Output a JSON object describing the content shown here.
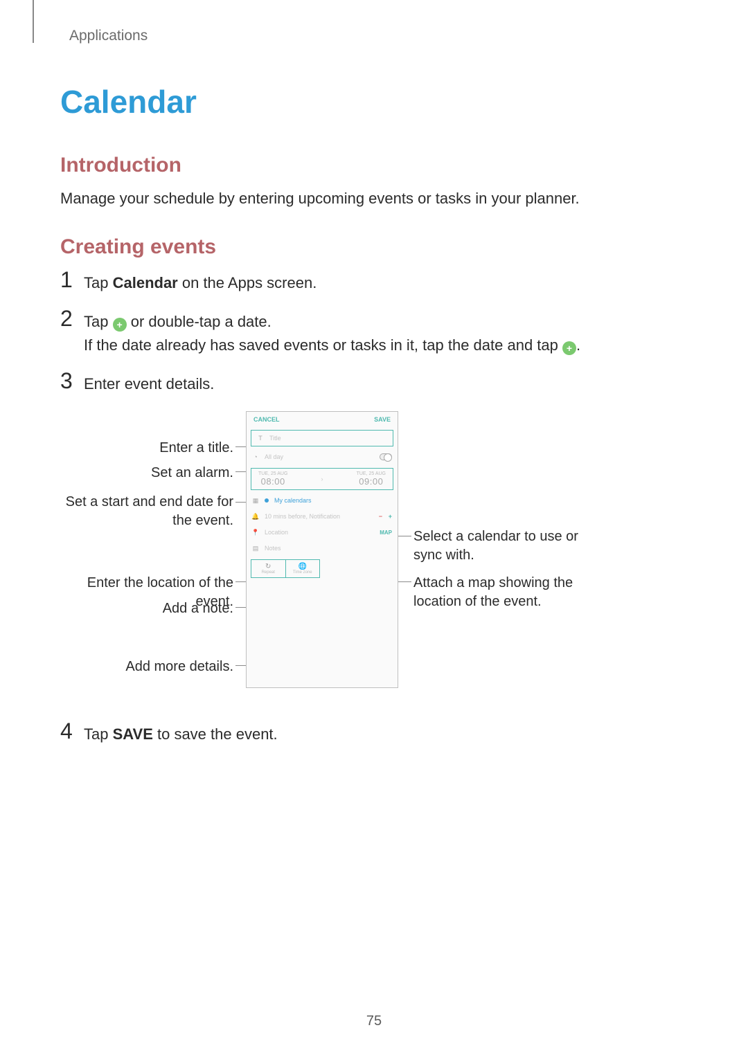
{
  "header": {
    "breadcrumb": "Applications"
  },
  "title": "Calendar",
  "sections": {
    "intro": {
      "heading": "Introduction",
      "text": "Manage your schedule by entering upcoming events or tasks in your planner."
    },
    "creating": {
      "heading": "Creating events",
      "step1_prefix": "Tap ",
      "step1_bold": "Calendar",
      "step1_suffix": " on the Apps screen.",
      "step2_prefix": "Tap ",
      "step2_suffix": " or double-tap a date.",
      "step2_line2_prefix": "If the date already has saved events or tasks in it, tap the date and tap ",
      "step2_line2_suffix": ".",
      "step3": "Enter event details.",
      "step4_prefix": "Tap ",
      "step4_bold": "SAVE",
      "step4_suffix": " to save the event."
    }
  },
  "steps": {
    "n1": "1",
    "n2": "2",
    "n3": "3",
    "n4": "4"
  },
  "callouts": {
    "title": "Enter a title.",
    "alarm": "Set an alarm.",
    "dates": "Set a start and end date for the event.",
    "location": "Enter the location of the event.",
    "note": "Add a note.",
    "more": "Add more details.",
    "calendar": "Select a calendar to use or sync with.",
    "map": "Attach a map showing the location of the event."
  },
  "phone": {
    "cancel": "CANCEL",
    "save": "SAVE",
    "title_placeholder": "Title",
    "allday": "All day",
    "start_label": "TUE, 25 AUG",
    "start_time": "08:00",
    "end_label": "TUE, 25 AUG",
    "end_time": "09:00",
    "mycal": "My calendars",
    "notif": "10 mins before, Notification",
    "location_placeholder": "Location",
    "map_chip": "MAP",
    "notes_placeholder": "Notes",
    "repeat": "Repeat",
    "timezone": "Time zone"
  },
  "page_number": "75"
}
